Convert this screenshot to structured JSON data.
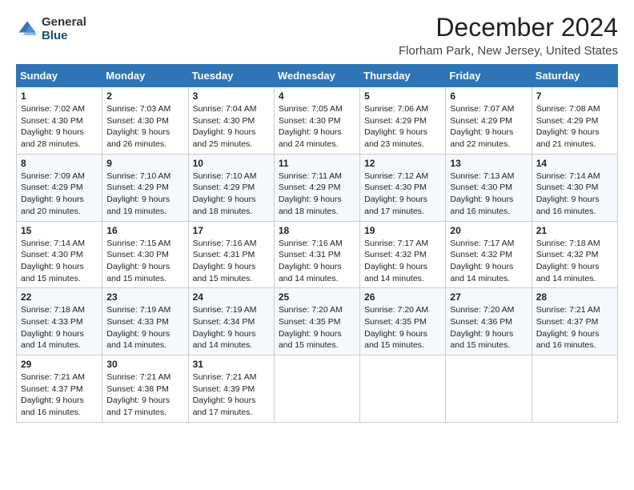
{
  "logo": {
    "text_general": "General",
    "text_blue": "Blue"
  },
  "title": "December 2024",
  "subtitle": "Florham Park, New Jersey, United States",
  "days_of_week": [
    "Sunday",
    "Monday",
    "Tuesday",
    "Wednesday",
    "Thursday",
    "Friday",
    "Saturday"
  ],
  "weeks": [
    [
      {
        "day": 1,
        "sunrise": "7:02 AM",
        "sunset": "4:30 PM",
        "daylight": "9 hours and 28 minutes."
      },
      {
        "day": 2,
        "sunrise": "7:03 AM",
        "sunset": "4:30 PM",
        "daylight": "9 hours and 26 minutes."
      },
      {
        "day": 3,
        "sunrise": "7:04 AM",
        "sunset": "4:30 PM",
        "daylight": "9 hours and 25 minutes."
      },
      {
        "day": 4,
        "sunrise": "7:05 AM",
        "sunset": "4:30 PM",
        "daylight": "9 hours and 24 minutes."
      },
      {
        "day": 5,
        "sunrise": "7:06 AM",
        "sunset": "4:29 PM",
        "daylight": "9 hours and 23 minutes."
      },
      {
        "day": 6,
        "sunrise": "7:07 AM",
        "sunset": "4:29 PM",
        "daylight": "9 hours and 22 minutes."
      },
      {
        "day": 7,
        "sunrise": "7:08 AM",
        "sunset": "4:29 PM",
        "daylight": "9 hours and 21 minutes."
      }
    ],
    [
      {
        "day": 8,
        "sunrise": "7:09 AM",
        "sunset": "4:29 PM",
        "daylight": "9 hours and 20 minutes."
      },
      {
        "day": 9,
        "sunrise": "7:10 AM",
        "sunset": "4:29 PM",
        "daylight": "9 hours and 19 minutes."
      },
      {
        "day": 10,
        "sunrise": "7:10 AM",
        "sunset": "4:29 PM",
        "daylight": "9 hours and 18 minutes."
      },
      {
        "day": 11,
        "sunrise": "7:11 AM",
        "sunset": "4:29 PM",
        "daylight": "9 hours and 18 minutes."
      },
      {
        "day": 12,
        "sunrise": "7:12 AM",
        "sunset": "4:30 PM",
        "daylight": "9 hours and 17 minutes."
      },
      {
        "day": 13,
        "sunrise": "7:13 AM",
        "sunset": "4:30 PM",
        "daylight": "9 hours and 16 minutes."
      },
      {
        "day": 14,
        "sunrise": "7:14 AM",
        "sunset": "4:30 PM",
        "daylight": "9 hours and 16 minutes."
      }
    ],
    [
      {
        "day": 15,
        "sunrise": "7:14 AM",
        "sunset": "4:30 PM",
        "daylight": "9 hours and 15 minutes."
      },
      {
        "day": 16,
        "sunrise": "7:15 AM",
        "sunset": "4:30 PM",
        "daylight": "9 hours and 15 minutes."
      },
      {
        "day": 17,
        "sunrise": "7:16 AM",
        "sunset": "4:31 PM",
        "daylight": "9 hours and 15 minutes."
      },
      {
        "day": 18,
        "sunrise": "7:16 AM",
        "sunset": "4:31 PM",
        "daylight": "9 hours and 14 minutes."
      },
      {
        "day": 19,
        "sunrise": "7:17 AM",
        "sunset": "4:32 PM",
        "daylight": "9 hours and 14 minutes."
      },
      {
        "day": 20,
        "sunrise": "7:17 AM",
        "sunset": "4:32 PM",
        "daylight": "9 hours and 14 minutes."
      },
      {
        "day": 21,
        "sunrise": "7:18 AM",
        "sunset": "4:32 PM",
        "daylight": "9 hours and 14 minutes."
      }
    ],
    [
      {
        "day": 22,
        "sunrise": "7:18 AM",
        "sunset": "4:33 PM",
        "daylight": "9 hours and 14 minutes."
      },
      {
        "day": 23,
        "sunrise": "7:19 AM",
        "sunset": "4:33 PM",
        "daylight": "9 hours and 14 minutes."
      },
      {
        "day": 24,
        "sunrise": "7:19 AM",
        "sunset": "4:34 PM",
        "daylight": "9 hours and 14 minutes."
      },
      {
        "day": 25,
        "sunrise": "7:20 AM",
        "sunset": "4:35 PM",
        "daylight": "9 hours and 15 minutes."
      },
      {
        "day": 26,
        "sunrise": "7:20 AM",
        "sunset": "4:35 PM",
        "daylight": "9 hours and 15 minutes."
      },
      {
        "day": 27,
        "sunrise": "7:20 AM",
        "sunset": "4:36 PM",
        "daylight": "9 hours and 15 minutes."
      },
      {
        "day": 28,
        "sunrise": "7:21 AM",
        "sunset": "4:37 PM",
        "daylight": "9 hours and 16 minutes."
      }
    ],
    [
      {
        "day": 29,
        "sunrise": "7:21 AM",
        "sunset": "4:37 PM",
        "daylight": "9 hours and 16 minutes."
      },
      {
        "day": 30,
        "sunrise": "7:21 AM",
        "sunset": "4:38 PM",
        "daylight": "9 hours and 17 minutes."
      },
      {
        "day": 31,
        "sunrise": "7:21 AM",
        "sunset": "4:39 PM",
        "daylight": "9 hours and 17 minutes."
      },
      null,
      null,
      null,
      null
    ]
  ],
  "labels": {
    "sunrise": "Sunrise:",
    "sunset": "Sunset:",
    "daylight": "Daylight:"
  }
}
